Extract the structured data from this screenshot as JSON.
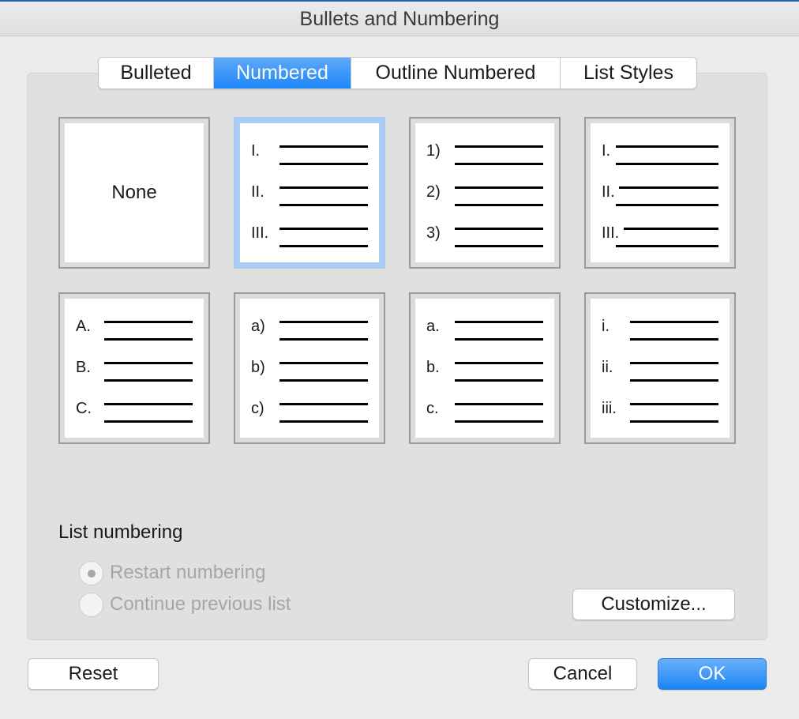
{
  "window": {
    "title": "Bullets and Numbering"
  },
  "tabs": [
    {
      "label": "Bulleted",
      "selected": false
    },
    {
      "label": "Numbered",
      "selected": true
    },
    {
      "label": "Outline Numbered",
      "selected": false
    },
    {
      "label": "List Styles",
      "selected": false
    }
  ],
  "styles": {
    "none_label": "None",
    "roman_upper": [
      "I.",
      "II.",
      "III."
    ],
    "digit_paren": [
      "1)",
      "2)",
      "3)"
    ],
    "roman_upper_tight": [
      "I.",
      "II.",
      "III."
    ],
    "alpha_upper": [
      "A.",
      "B.",
      "C."
    ],
    "alpha_lower_paren": [
      "a)",
      "b)",
      "c)"
    ],
    "alpha_lower": [
      "a.",
      "b.",
      "c."
    ],
    "roman_lower": [
      "i.",
      "ii.",
      "iii."
    ]
  },
  "list_numbering": {
    "title": "List numbering",
    "restart_label": "Restart numbering",
    "continue_label": "Continue previous list",
    "selected": "restart",
    "enabled": false
  },
  "buttons": {
    "customize": "Customize...",
    "reset": "Reset",
    "cancel": "Cancel",
    "ok": "OK"
  },
  "colors": {
    "accent": "#1d86f6",
    "selected_tile_border": "#a9cdf5"
  }
}
